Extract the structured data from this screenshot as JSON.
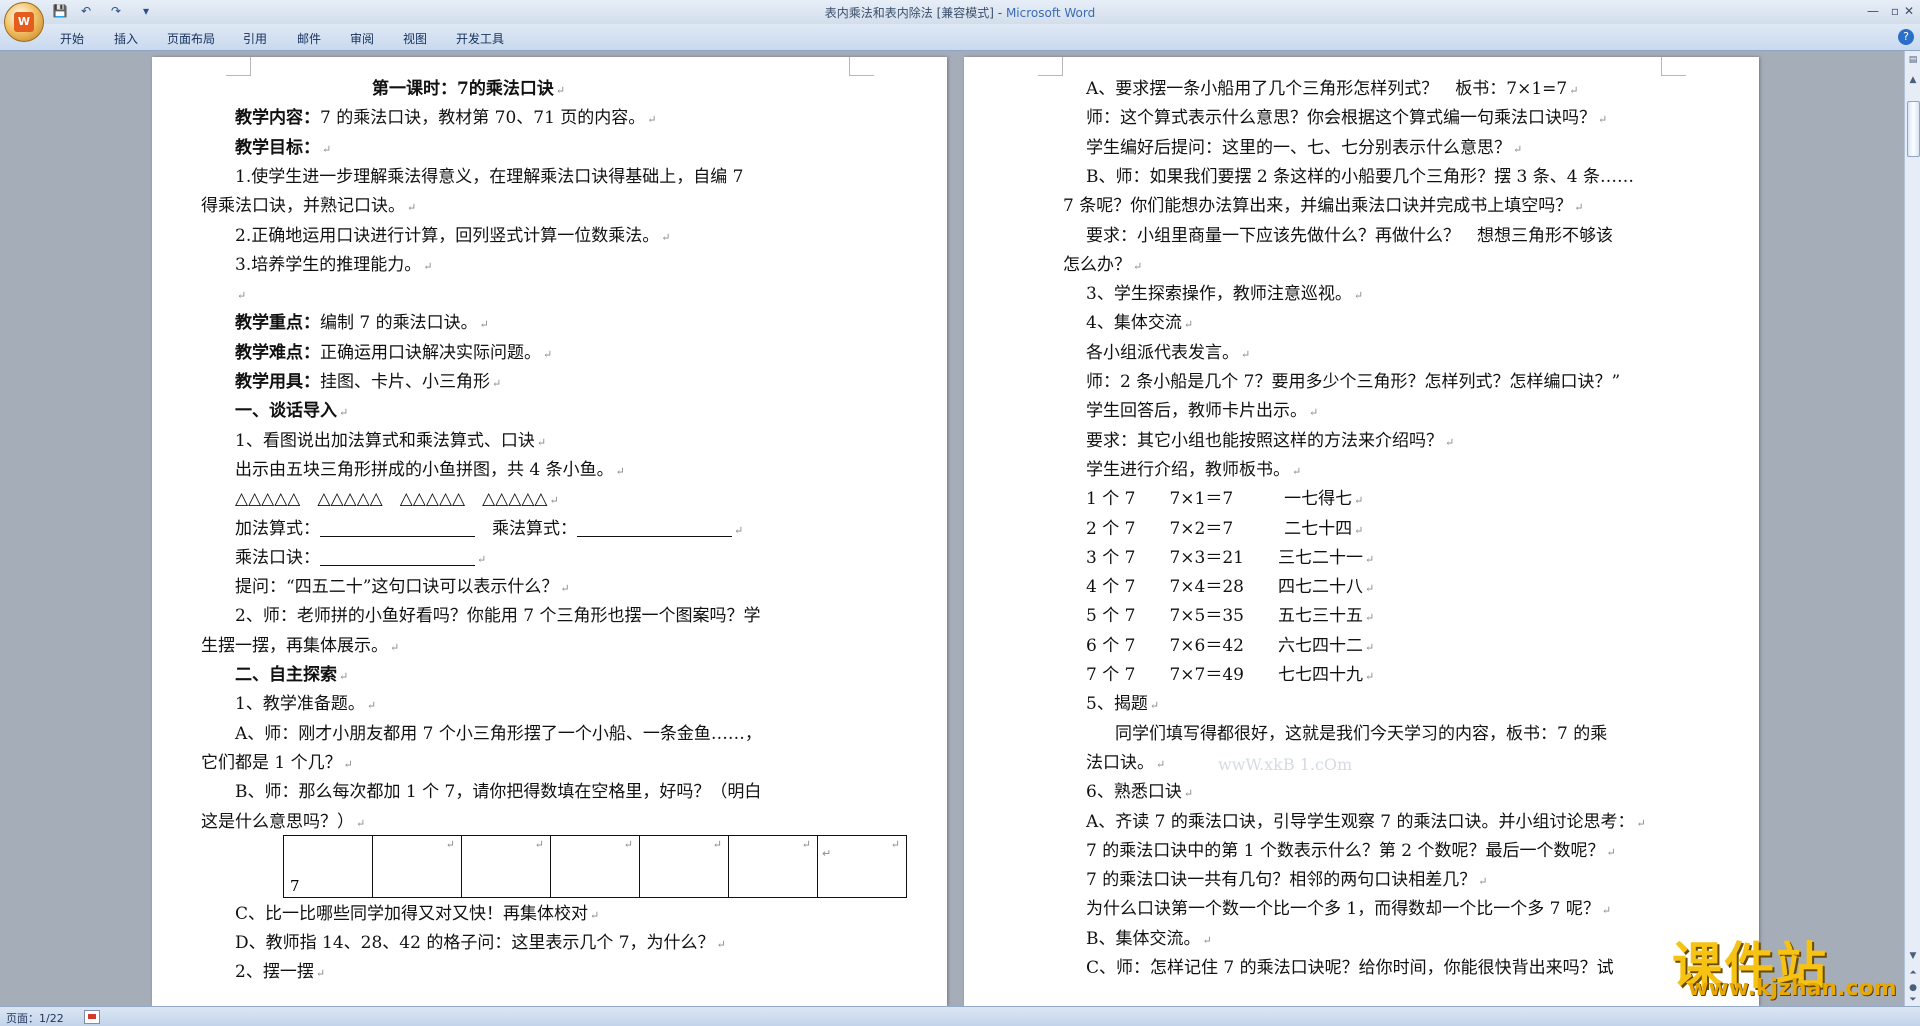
{
  "window": {
    "title_doc": "表内乘法和表内除法 [兼容模式]",
    "title_sep": " - ",
    "title_app": "Microsoft Word",
    "minimize": "—",
    "restore": "▫",
    "close": "✕"
  },
  "qat": {
    "save": "💾",
    "undo": "↶",
    "redo": "↷",
    "customize": "▾"
  },
  "ribbon": {
    "tabs": [
      "开始",
      "插入",
      "页面布局",
      "引用",
      "邮件",
      "审阅",
      "视图",
      "开发工具"
    ],
    "help": "?"
  },
  "left_page": {
    "lines": [
      {
        "runs": [
          {
            "t": "第一课时：7的乘法口诀",
            "b": true
          },
          {
            "t": "↵",
            "pm": true
          }
        ]
      },
      {
        "runs": [
          {
            "t": "教学内容：",
            "b": true
          },
          {
            "t": "7 的乘法口诀，教材第 70、71 页的内容。"
          },
          {
            "t": "↵",
            "pm": true
          }
        ]
      },
      {
        "runs": [
          {
            "t": "教学目标：",
            "b": true
          },
          {
            "t": "↵",
            "pm": true
          }
        ]
      },
      {
        "runs": [
          {
            "t": "1.使学生进一步理解乘法得意义，在理解乘法口诀得基础上，自编 7"
          }
        ]
      },
      {
        "runs": [
          {
            "t": "得乘法口诀，并熟记口诀。"
          },
          {
            "t": "↵",
            "pm": true
          }
        ]
      },
      {
        "runs": [
          {
            "t": "2.正确地运用口诀进行计算，回列竖式计算一位数乘法。"
          },
          {
            "t": "↵",
            "pm": true
          }
        ]
      },
      {
        "runs": [
          {
            "t": "3.培养学生的推理能力。"
          },
          {
            "t": "↵",
            "pm": true
          }
        ]
      },
      {
        "runs": [
          {
            "t": "↵",
            "pm": true
          }
        ]
      },
      {
        "runs": [
          {
            "t": "教学重点：",
            "b": true
          },
          {
            "t": "编制 7 的乘法口诀。"
          },
          {
            "t": "↵",
            "pm": true
          }
        ]
      },
      {
        "runs": [
          {
            "t": "教学难点：",
            "b": true
          },
          {
            "t": "正确运用口诀解决实际问题。"
          },
          {
            "t": "↵",
            "pm": true
          }
        ]
      },
      {
        "runs": [
          {
            "t": "教学用具：",
            "b": true
          },
          {
            "t": "挂图、卡片、小三角形"
          },
          {
            "t": "↵",
            "pm": true
          }
        ]
      },
      {
        "runs": [
          {
            "t": "一、谈话导入",
            "b": true
          },
          {
            "t": "↵",
            "pm": true
          }
        ]
      },
      {
        "runs": [
          {
            "t": "1、看图说出加法算式和乘法算式、口诀"
          },
          {
            "t": "↵",
            "pm": true
          }
        ]
      },
      {
        "runs": [
          {
            "t": "出示由五块三角形拼成的小鱼拼图，共 4 条小鱼。"
          },
          {
            "t": "↵",
            "pm": true
          }
        ]
      },
      {
        "runs": [
          {
            "t": "△△△△△　△△△△△　△△△△△　△△△△△"
          },
          {
            "t": "↵",
            "pm": true
          }
        ]
      },
      {
        "runs": [
          {
            "t": "加法算式："
          },
          {
            "u": true
          },
          {
            "t": "　乘法算式："
          },
          {
            "u": true
          },
          {
            "t": "↵",
            "pm": true
          }
        ]
      },
      {
        "runs": [
          {
            "t": "乘法口诀："
          },
          {
            "u": true
          },
          {
            "t": "↵",
            "pm": true
          }
        ]
      },
      {
        "runs": [
          {
            "t": "提问：“四五二十”这句口诀可以表示什么？"
          },
          {
            "t": "↵",
            "pm": true
          }
        ]
      },
      {
        "runs": [
          {
            "t": "2、师：老师拼的小鱼好看吗？你能用 7 个三角形也摆一个图案吗？学"
          }
        ]
      },
      {
        "runs": [
          {
            "t": "生摆一摆，再集体展示。"
          },
          {
            "t": "↵",
            "pm": true
          }
        ]
      },
      {
        "runs": [
          {
            "t": "二、自主探索",
            "b": true
          },
          {
            "t": "↵",
            "pm": true
          }
        ]
      },
      {
        "runs": [
          {
            "t": "1、教学准备题。"
          },
          {
            "t": "↵",
            "pm": true
          }
        ]
      },
      {
        "runs": [
          {
            "t": "A、师：刚才小朋友都用 7 个小三角形摆了一个小船、一条金鱼……，"
          }
        ]
      },
      {
        "runs": [
          {
            "t": "它们都是 1 个几？"
          },
          {
            "t": "↵",
            "pm": true
          }
        ]
      },
      {
        "runs": [
          {
            "t": "B、师：那么每次都加 1 个 7，请你把得数填在空格里，好吗？（明白"
          }
        ]
      },
      {
        "runs": [
          {
            "t": "这是什么意思吗？）"
          },
          {
            "t": "↵",
            "pm": true
          }
        ]
      },
      {
        "runs": [
          {
            "t": "C、比一比哪些同学加得又对又快！再集体校对"
          },
          {
            "t": "↵",
            "pm": true
          }
        ]
      },
      {
        "runs": [
          {
            "t": "D、教师指 14、28、42 的格子问：这里表示几个 7，为什么？"
          },
          {
            "t": "↵",
            "pm": true
          }
        ]
      },
      {
        "runs": [
          {
            "t": "2、摆一摆"
          },
          {
            "t": "↵",
            "pm": true
          }
        ]
      }
    ],
    "table": {
      "first_cell": "7",
      "mark": "↵",
      "row_end": "↵"
    }
  },
  "right_page": {
    "lines": [
      {
        "runs": [
          {
            "t": "A、要求摆一条小船用了几个三角形怎样列式？　板书：7×1=7"
          },
          {
            "t": "↵",
            "pm": true
          }
        ]
      },
      {
        "runs": [
          {
            "t": "师：这个算式表示什么意思？你会根据这个算式编一句乘法口诀吗？"
          },
          {
            "t": "↵",
            "pm": true
          }
        ]
      },
      {
        "runs": [
          {
            "t": "学生编好后提问：这里的一、七、七分别表示什么意思？"
          },
          {
            "t": "↵",
            "pm": true
          }
        ]
      },
      {
        "runs": [
          {
            "t": "B、师：如果我们要摆 2 条这样的小船要几个三角形？摆 3 条、4 条……"
          }
        ]
      },
      {
        "runs": [
          {
            "t": "7 条呢？你们能想办法算出来，并编出乘法口诀并完成书上填空吗？"
          },
          {
            "t": "↵",
            "pm": true
          }
        ]
      },
      {
        "runs": [
          {
            "t": "要求：小组里商量一下应该先做什么？再做什么？　想想三角形不够该"
          }
        ]
      },
      {
        "runs": [
          {
            "t": "怎么办？"
          },
          {
            "t": "↵",
            "pm": true
          }
        ]
      },
      {
        "runs": [
          {
            "t": "3、学生探索操作，教师注意巡视。"
          },
          {
            "t": "↵",
            "pm": true
          }
        ]
      },
      {
        "runs": [
          {
            "t": "4、集体交流"
          },
          {
            "t": "↵",
            "pm": true
          }
        ]
      },
      {
        "runs": [
          {
            "t": "各小组派代表发言。"
          },
          {
            "t": "↵",
            "pm": true
          }
        ]
      },
      {
        "runs": [
          {
            "t": "师：2 条小船是几个 7？要用多少个三角形？怎样列式？怎样编口诀？”"
          }
        ]
      },
      {
        "runs": [
          {
            "t": "学生回答后，教师卡片出示。"
          },
          {
            "t": "↵",
            "pm": true
          }
        ]
      },
      {
        "runs": [
          {
            "t": "要求：其它小组也能按照这样的方法来介绍吗？"
          },
          {
            "t": "↵",
            "pm": true
          }
        ]
      },
      {
        "runs": [
          {
            "t": "学生进行介绍，教师板书。"
          },
          {
            "t": "↵",
            "pm": true
          }
        ]
      },
      {
        "runs": [
          {
            "t": "1 个 7　　7×1＝7　　　一七得七"
          },
          {
            "t": "↵",
            "pm": true
          }
        ]
      },
      {
        "runs": [
          {
            "t": "2 个 7　　7×2＝7　　　二七十四"
          },
          {
            "t": "↵",
            "pm": true
          }
        ]
      },
      {
        "runs": [
          {
            "t": "3 个 7　　7×3＝21　　三七二十一"
          },
          {
            "t": "↵",
            "pm": true
          }
        ]
      },
      {
        "runs": [
          {
            "t": "4 个 7　　7×4＝28　　四七二十八"
          },
          {
            "t": "↵",
            "pm": true
          }
        ]
      },
      {
        "runs": [
          {
            "t": "5 个 7　　7×5＝35　　五七三十五"
          },
          {
            "t": "↵",
            "pm": true
          }
        ]
      },
      {
        "runs": [
          {
            "t": "6 个 7　　7×6＝42　　六七四十二"
          },
          {
            "t": "↵",
            "pm": true
          }
        ]
      },
      {
        "runs": [
          {
            "t": "7 个 7　　7×7＝49　　七七四十九"
          },
          {
            "t": "↵",
            "pm": true
          }
        ]
      },
      {
        "runs": [
          {
            "t": "5、揭题"
          },
          {
            "t": "↵",
            "pm": true
          }
        ]
      },
      {
        "runs": [
          {
            "t": "同学们填写得都很好，这就是我们今天学习的内容，板书：7 的乘"
          }
        ]
      },
      {
        "runs": [
          {
            "t": "法口诀。"
          },
          {
            "t": "↵",
            "pm": true
          }
        ]
      },
      {
        "runs": [
          {
            "t": "6、熟悉口诀"
          },
          {
            "t": "↵",
            "pm": true
          }
        ]
      },
      {
        "runs": [
          {
            "t": "A、齐读 7 的乘法口诀，引导学生观察 7 的乘法口诀。并小组讨论思考："
          },
          {
            "t": "↵",
            "pm": true
          }
        ]
      },
      {
        "runs": [
          {
            "t": "7 的乘法口诀中的第 1 个数表示什么？第 2 个数呢？最后一个数呢？"
          },
          {
            "t": "↵",
            "pm": true
          }
        ]
      },
      {
        "runs": [
          {
            "t": "7 的乘法口诀一共有几句？相邻的两句口诀相差几？"
          },
          {
            "t": "↵",
            "pm": true
          }
        ]
      },
      {
        "runs": [
          {
            "t": "为什么口诀第一个数一个比一个多 1，而得数却一个比一个多 7 呢？"
          },
          {
            "t": "↵",
            "pm": true
          }
        ]
      },
      {
        "runs": [
          {
            "t": "B、集体交流。"
          },
          {
            "t": "↵",
            "pm": true
          }
        ]
      },
      {
        "runs": [
          {
            "t": "C、师：怎样记住 7 的乘法口诀呢？给你时间，你能很快背出来吗？试"
          }
        ]
      }
    ],
    "watermark": "wwW.xkB 1.cOm"
  },
  "status": {
    "page": "页面：1/22"
  },
  "brand": {
    "name": "课件站",
    "url": "www.kjzhan.com"
  }
}
